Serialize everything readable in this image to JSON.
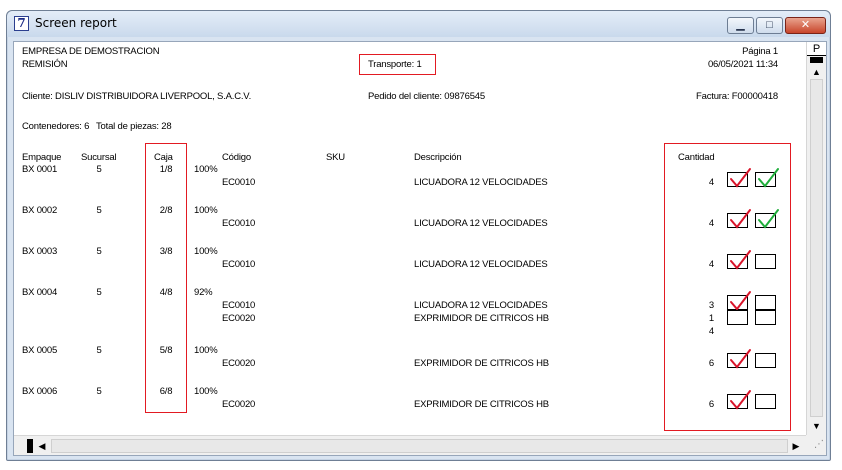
{
  "window": {
    "title": "Screen report",
    "icon_glyph": "7",
    "controls": {
      "minimize": "▁",
      "maximize": "□",
      "close": "✕"
    }
  },
  "header": {
    "company": "EMPRESA DE DEMOSTRACION",
    "document": "REMISIÓN",
    "transport": "Transporte: 1",
    "page": "Página 1",
    "datetime": "06/05/2021  11:34",
    "client": "Cliente: DISLIV  DISTRIBUIDORA LIVERPOOL, S.A.C.V.",
    "customer_order": "Pedido del cliente: 09876545",
    "invoice": "Factura: F00000418",
    "containers": "Contenedores: 6",
    "pieces": "Total de piezas: 28"
  },
  "columns": {
    "package": "Empaque",
    "branch": "Sucursal",
    "box": "Caja",
    "code": "Código",
    "sku": "SKU",
    "description": "Descripción",
    "quantity": "Cantidad"
  },
  "rows": [
    {
      "package": "BX  0001",
      "branch": "5",
      "box": "1/8",
      "pct": "100%",
      "items": [
        {
          "code": "EC0010",
          "desc": "LICUADORA 12 VELOCIDADES",
          "qty": "4",
          "checked": true,
          "verified": true
        }
      ]
    },
    {
      "package": "BX  0002",
      "branch": "5",
      "box": "2/8",
      "pct": "100%",
      "items": [
        {
          "code": "EC0010",
          "desc": "LICUADORA 12 VELOCIDADES",
          "qty": "4",
          "checked": true,
          "verified": true
        }
      ]
    },
    {
      "package": "BX  0003",
      "branch": "5",
      "box": "3/8",
      "pct": "100%",
      "items": [
        {
          "code": "EC0010",
          "desc": "LICUADORA 12 VELOCIDADES",
          "qty": "4",
          "checked": true,
          "verified": false
        }
      ]
    },
    {
      "package": "BX  0004",
      "branch": "5",
      "box": "4/8",
      "pct": "92%",
      "items": [
        {
          "code": "EC0010",
          "desc": "LICUADORA 12 VELOCIDADES",
          "qty": "3",
          "checked": true,
          "verified": false
        },
        {
          "code": "EC0020",
          "desc": "EXPRIMIDOR DE CITRICOS HB",
          "qty": "1",
          "checked": false,
          "verified": false
        }
      ],
      "total_qty": "4"
    },
    {
      "package": "BX  0005",
      "branch": "5",
      "box": "5/8",
      "pct": "100%",
      "items": [
        {
          "code": "EC0020",
          "desc": "EXPRIMIDOR DE CITRICOS HB",
          "qty": "6",
          "checked": true,
          "verified": false
        }
      ]
    },
    {
      "package": "BX  0006",
      "branch": "5",
      "box": "6/8",
      "pct": "100%",
      "items": [
        {
          "code": "EC0020",
          "desc": "EXPRIMIDOR DE CITRICOS HB",
          "qty": "6",
          "checked": true,
          "verified": false
        }
      ]
    }
  ],
  "scrollbars": {
    "vertical_marker": "P"
  },
  "colors": {
    "highlight_box": "#e21a22",
    "check_red": "#d9142a",
    "check_green": "#1fae3b"
  }
}
